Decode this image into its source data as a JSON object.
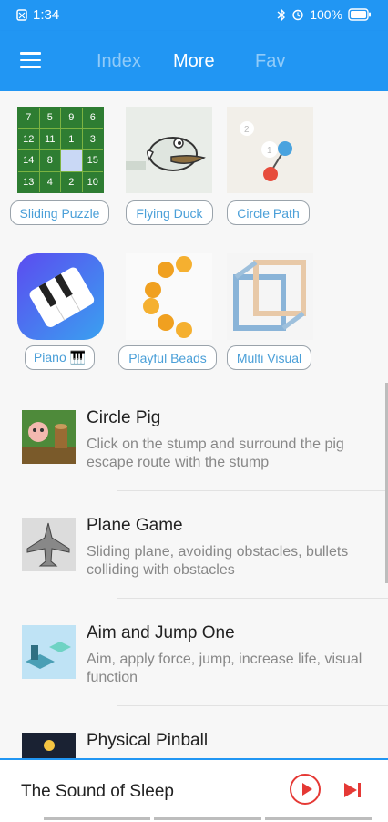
{
  "status_bar": {
    "time": "1:34",
    "battery": "100%"
  },
  "tabs": [
    {
      "label": "Index",
      "active": false
    },
    {
      "label": "More",
      "active": true
    },
    {
      "label": "Fav",
      "active": false
    }
  ],
  "grid": {
    "items": [
      {
        "label": "Sliding Puzzle",
        "icon": "sliding-puzzle-thumbnail"
      },
      {
        "label": "Flying Duck",
        "icon": "flying-duck-thumbnail"
      },
      {
        "label": "Circle Path",
        "icon": "circle-path-thumbnail"
      },
      {
        "label": "Piano 🎹",
        "icon": "piano-app-icon"
      },
      {
        "label": "Playful Beads",
        "icon": "beads-thumbnail"
      },
      {
        "label": "Multi Visual",
        "icon": "impossible-cube-thumbnail"
      }
    ],
    "puzzle_numbers": [
      "7",
      "5",
      "9",
      "6",
      "12",
      "11",
      "1",
      "3",
      "14",
      "8",
      "",
      "15",
      "13",
      "4",
      "2",
      "10"
    ],
    "path_numbers": [
      "2",
      "1"
    ]
  },
  "list": [
    {
      "title": "Circle Pig",
      "desc": "Click on the stump and surround the pig escape route with the stump"
    },
    {
      "title": "Plane Game",
      "desc": "Sliding plane, avoiding obstacles, bullets colliding with obstacles"
    },
    {
      "title": "Aim and Jump One",
      "desc": "Aim, apply force, jump, increase life, visual function"
    },
    {
      "title": "Physical Pinball",
      "desc": ""
    }
  ],
  "player": {
    "track": "The Sound of Sleep"
  },
  "colors": {
    "primary": "#2196f3",
    "accent": "#e53935",
    "link": "#4a9fd8"
  }
}
